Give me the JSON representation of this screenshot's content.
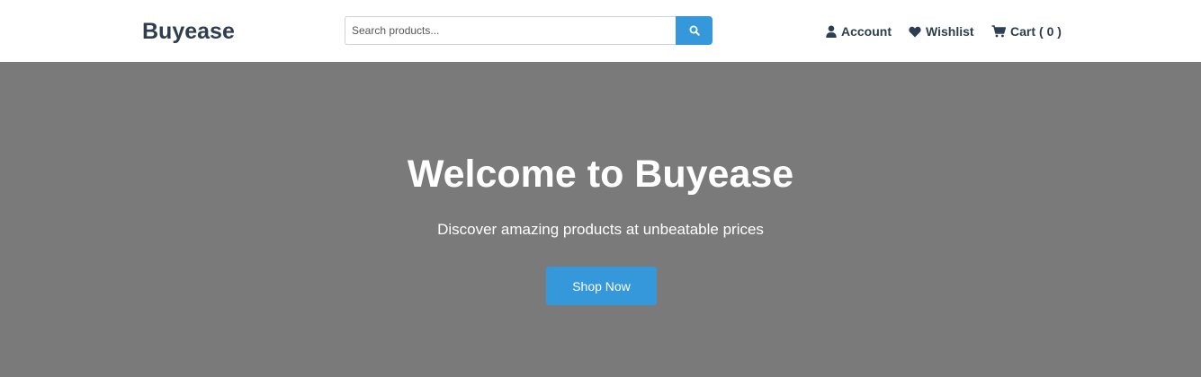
{
  "header": {
    "logo": "Buyease",
    "search": {
      "placeholder": "Search products...",
      "value": "",
      "button_icon": "search-icon"
    },
    "nav": {
      "account_label": "Account",
      "wishlist_label": "Wishlist",
      "cart_label": "Cart",
      "cart_count": "( 0 )"
    }
  },
  "hero": {
    "title": "Welcome to Buyease",
    "subtitle": "Discover amazing products at unbeatable prices",
    "cta_label": "Shop Now"
  },
  "colors": {
    "brand_text": "#2c3e50",
    "accent": "#3498db",
    "hero_background": "#7a7a7a"
  }
}
